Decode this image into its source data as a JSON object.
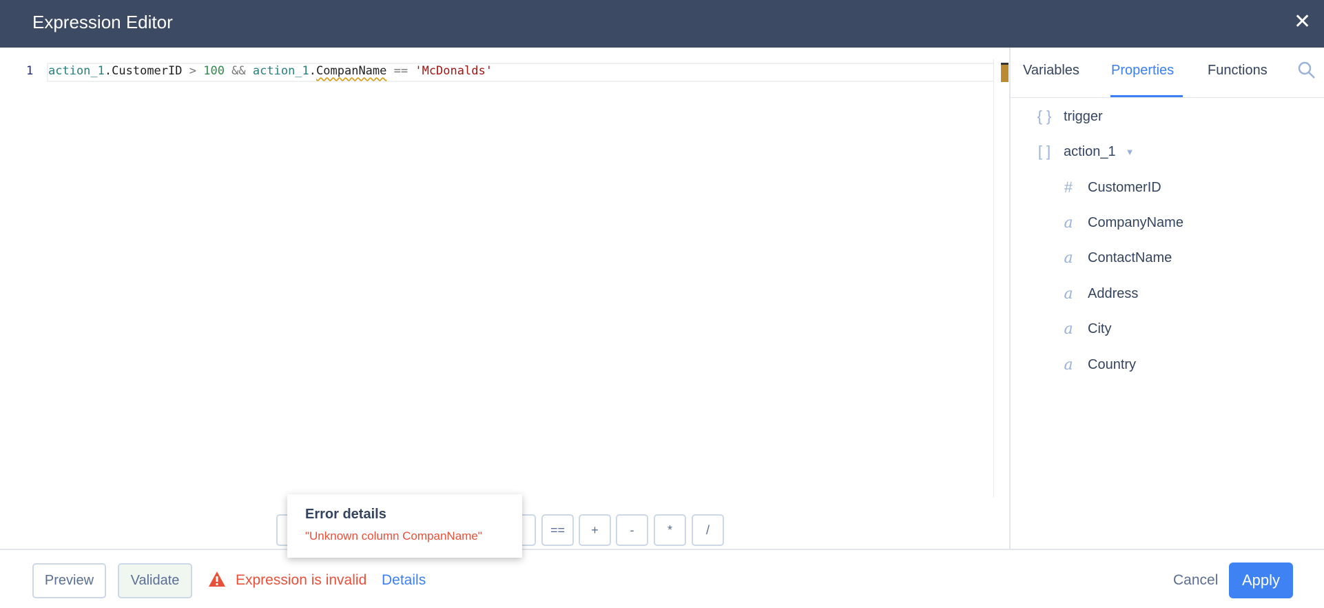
{
  "header": {
    "title": "Expression Editor",
    "close_icon": "close-icon"
  },
  "editor": {
    "line_number": "1",
    "tokens": {
      "v1": "action_1",
      "d1": ".",
      "p1": "CustomerID",
      "op1": " > ",
      "num": "100",
      "op2": " && ",
      "v2": "action_1",
      "d2": ".",
      "p2": "CompanName",
      "op3": " == ",
      "str": "'McDonalds'"
    },
    "error_underline_color": "#d4a017"
  },
  "panel": {
    "tabs": [
      {
        "label": "Variables"
      },
      {
        "label": "Properties",
        "active": true
      },
      {
        "label": "Functions"
      }
    ],
    "search_icon": "search-icon",
    "items": [
      {
        "icon": "{ }",
        "label": "trigger"
      },
      {
        "icon": "[ ]",
        "label": "action_1"
      }
    ],
    "fields": [
      {
        "icon": "#",
        "label": "CustomerID"
      },
      {
        "icon": "a",
        "label": "CompanyName"
      },
      {
        "icon": "a",
        "label": "ContactName"
      },
      {
        "icon": "a",
        "label": "Address"
      },
      {
        "icon": "a",
        "label": "City"
      },
      {
        "icon": "a",
        "label": "Country"
      }
    ]
  },
  "operators": [
    "&",
    "",
    "",
    "",
    "",
    "",
    "",
    "==",
    "+",
    "-",
    "*",
    "/"
  ],
  "footer": {
    "preview": "Preview",
    "validate": "Validate",
    "error": "Expression is invalid",
    "details": "Details",
    "cancel": "Cancel",
    "apply": "Apply"
  },
  "popup": {
    "title": "Error details",
    "message": "\"Unknown column CompanName\""
  },
  "colors": {
    "header": "#3d4a63",
    "accent": "#3b7ff0",
    "error": "#e8503a"
  }
}
